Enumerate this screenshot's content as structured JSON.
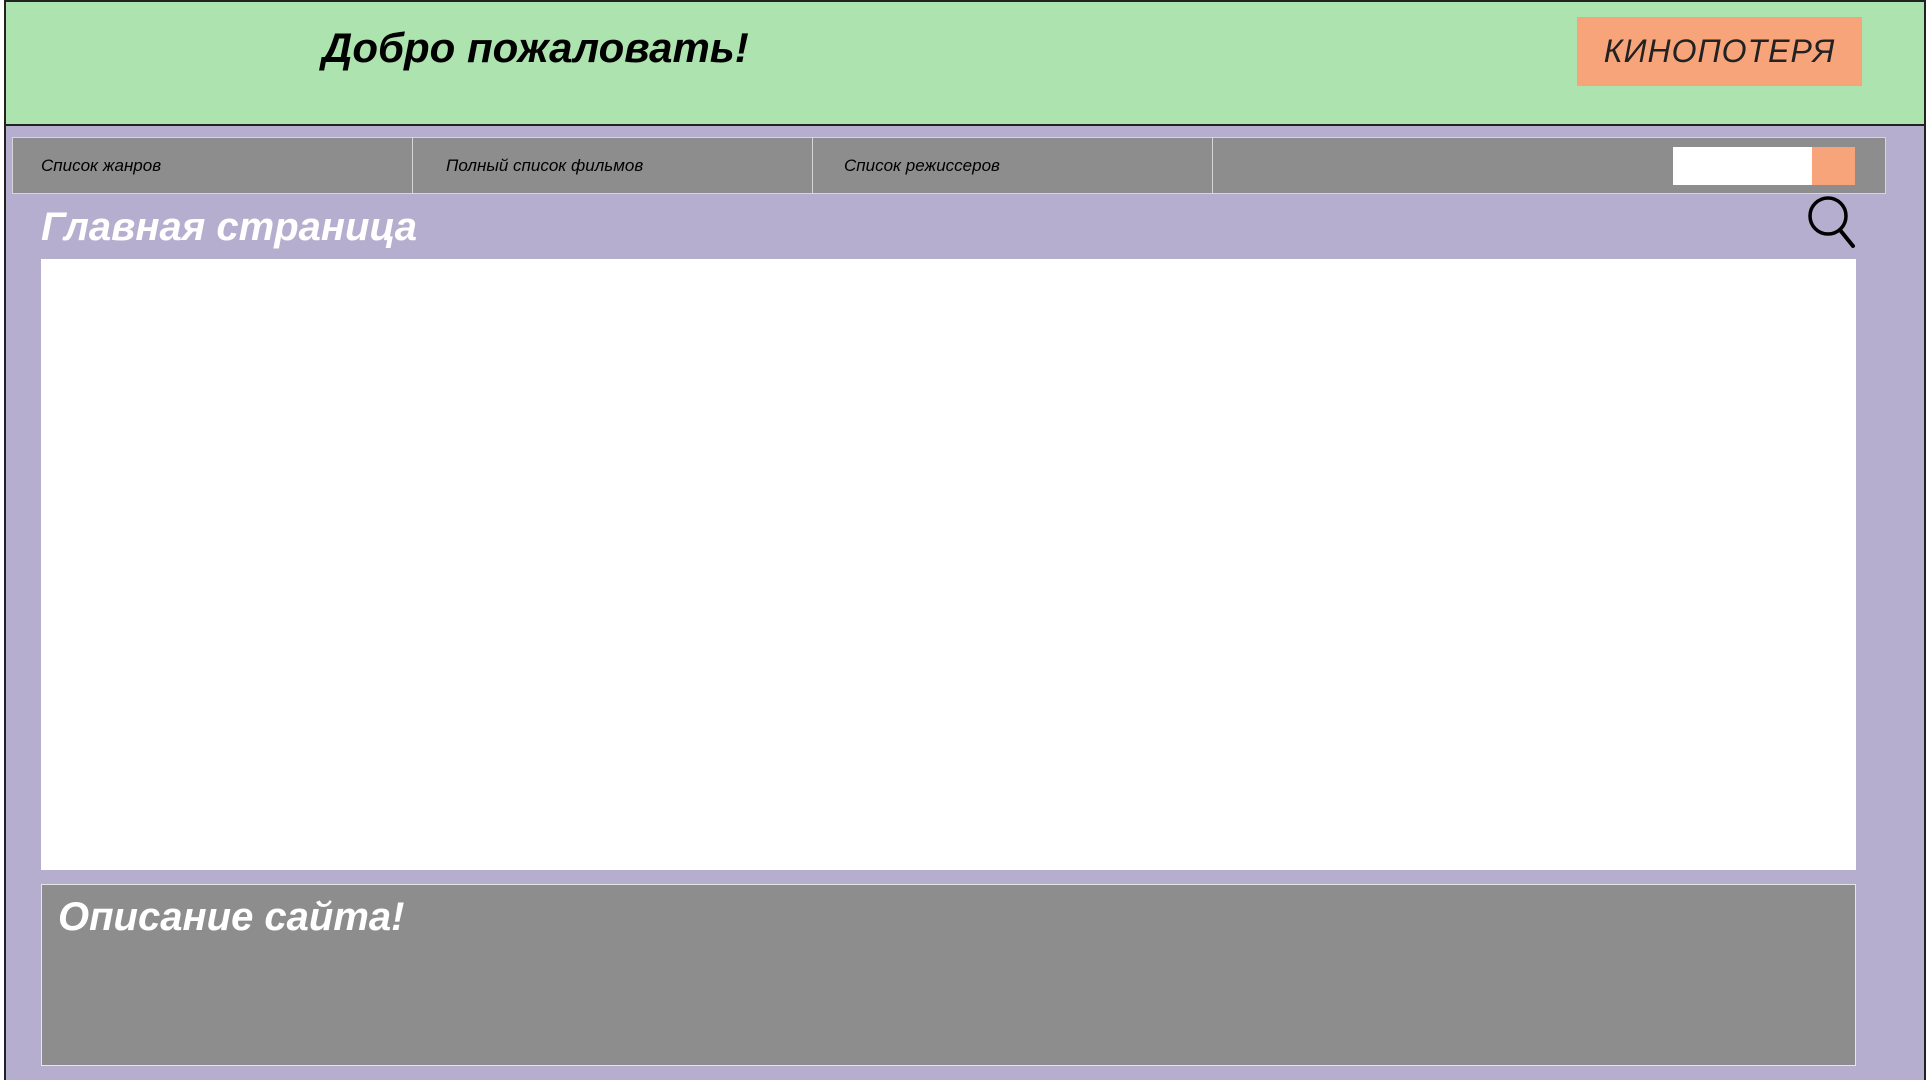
{
  "header": {
    "welcome": "Добро пожаловать!",
    "brand": "КИНОПОТЕРЯ"
  },
  "nav": {
    "items": [
      {
        "label": "Список жанров"
      },
      {
        "label": "Полный список фильмов"
      },
      {
        "label": "Список режиссеров"
      }
    ],
    "search": {
      "value": "",
      "placeholder": ""
    }
  },
  "main": {
    "title": "Главная страница"
  },
  "description": {
    "title": "Описание сайта!"
  },
  "colors": {
    "header_bg": "#ade3ae",
    "page_bg": "#b6aecf",
    "nav_bg": "#8d8d8d",
    "accent": "#f7a47b"
  },
  "icons": {
    "search": "search-icon"
  }
}
